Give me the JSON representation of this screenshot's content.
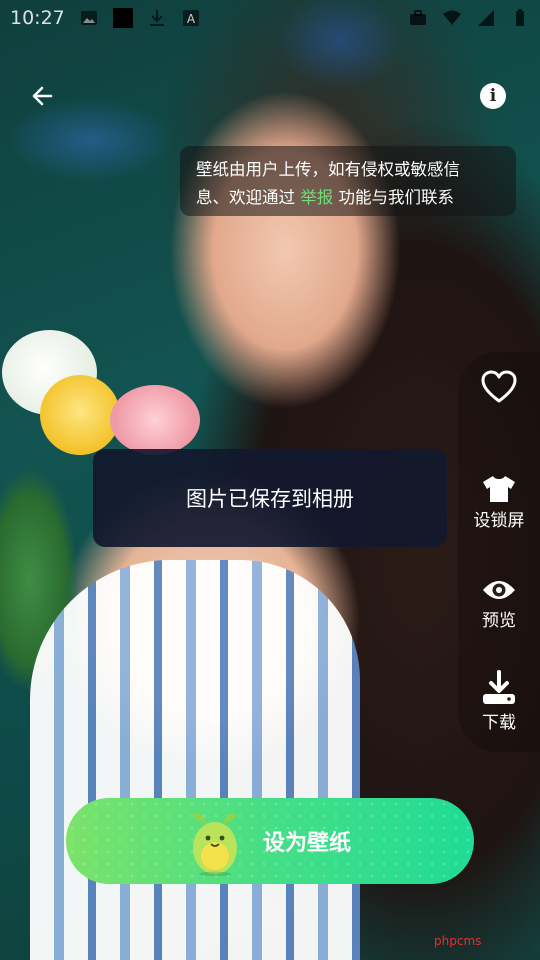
{
  "status_bar": {
    "time": "10:27",
    "left_icons": [
      "image-icon",
      "app-square-icon",
      "download-icon",
      "font-a-icon"
    ],
    "right_icons": [
      "briefcase-icon",
      "wifi-icon",
      "signal-icon",
      "battery-icon"
    ]
  },
  "header": {
    "back_icon": "arrow-left-icon",
    "info_icon": "info-icon",
    "info_glyph": "i"
  },
  "notice": {
    "line1": "壁纸由用户上传，如有侵权或敏感信",
    "line2_prefix": "息、欢迎通过 ",
    "report_link": "举报",
    "line2_suffix": " 功能与我们联系",
    "link_color": "#6fe07a"
  },
  "actions": [
    {
      "icon": "heart-icon",
      "label": ""
    },
    {
      "icon": "tshirt-icon",
      "label": "设锁屏"
    },
    {
      "icon": "eye-icon",
      "label": "预览"
    },
    {
      "icon": "download-icon",
      "label": "下载"
    }
  ],
  "toast": {
    "text": "图片已保存到相册"
  },
  "primary_button": {
    "label": "设为壁纸",
    "mascot_icon": "avocado-mascot-icon"
  },
  "watermark": "phpcms",
  "colors": {
    "button_gradient_start": "#7be36a",
    "button_gradient_end": "#1fdc95",
    "toast_bg": "#12182e",
    "watermark": "#e0322e"
  }
}
